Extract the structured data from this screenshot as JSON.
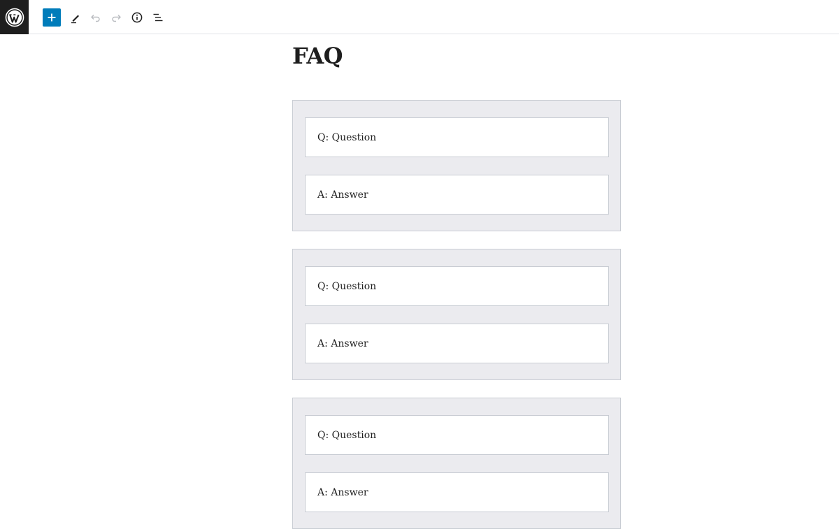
{
  "toolbar": {
    "logo_icon": "wordpress-logo-icon",
    "add_icon": "plus-icon",
    "edit_icon": "pencil-icon",
    "undo_icon": "undo-icon",
    "redo_icon": "redo-icon",
    "info_icon": "info-icon",
    "outline_icon": "list-view-icon",
    "accent_color": "#007cba"
  },
  "page": {
    "title": "FAQ"
  },
  "faq_items": [
    {
      "question": "Q: Question",
      "answer": "A: Answer"
    },
    {
      "question": "Q: Question",
      "answer": "A: Answer"
    },
    {
      "question": "Q: Question",
      "answer": "A: Answer"
    }
  ]
}
